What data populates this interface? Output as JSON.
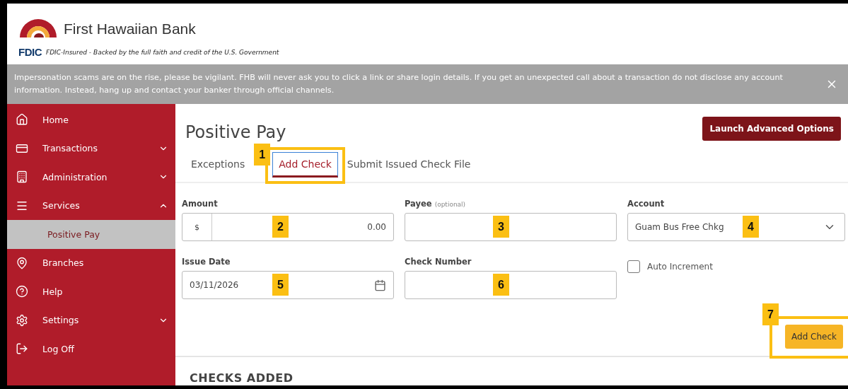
{
  "header": {
    "bank_name": "First Hawaiian Bank",
    "fdic_mark": "FDIC",
    "fdic_text": "FDIC-Insured - Backed by the full faith and credit of the U.S. Government"
  },
  "alert": {
    "text": "Impersonation scams are on the rise, please be vigilant. FHB will never ask you to click a link or share login details. If you get an unexpected call about a transaction do not disclose any account information. Instead, hang up and contact your banker through official channels."
  },
  "sidebar": {
    "items": [
      {
        "label": "Home",
        "selected": false
      },
      {
        "label": "Transactions",
        "selected": false,
        "expanded": false
      },
      {
        "label": "Administration",
        "selected": false,
        "expanded": false
      },
      {
        "label": "Services",
        "selected": false,
        "expanded": true,
        "children": [
          {
            "label": "Positive Pay",
            "selected": true
          }
        ]
      },
      {
        "label": "Branches",
        "selected": false
      },
      {
        "label": "Help",
        "selected": false
      },
      {
        "label": "Settings",
        "selected": false,
        "expanded": false
      },
      {
        "label": "Log Off",
        "selected": false
      }
    ]
  },
  "page": {
    "title": "Positive Pay",
    "advanced_button": "Launch Advanced Options",
    "tabs": [
      {
        "label": "Exceptions",
        "selected": false
      },
      {
        "label": "Add Check",
        "selected": true,
        "callout": "1"
      },
      {
        "label": "Submit Issued Check File",
        "selected": false
      }
    ],
    "form": {
      "amount": {
        "label": "Amount",
        "prefix": "$",
        "value": "0.00",
        "callout": "2"
      },
      "payee": {
        "label": "Payee",
        "hint": "(optional)",
        "callout": "3"
      },
      "account": {
        "label": "Account",
        "value": "Guam Bus Free Chkg",
        "callout": "4"
      },
      "issue_date": {
        "label": "Issue Date",
        "value": "03/11/2026",
        "callout": "5"
      },
      "check_number": {
        "label": "Check Number",
        "callout": "6"
      },
      "auto_increment": {
        "label": "Auto Increment",
        "checked": false
      },
      "submit": {
        "label": "Add Check",
        "callout": "7"
      }
    },
    "section_title": "CHECKS ADDED"
  }
}
